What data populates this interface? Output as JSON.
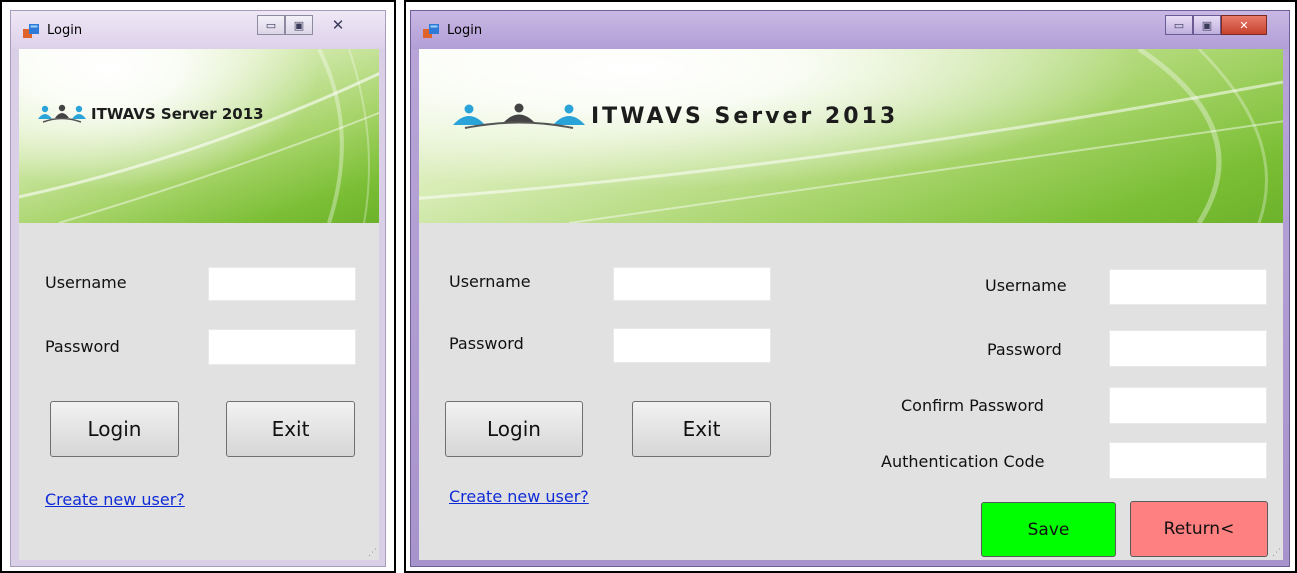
{
  "window_left": {
    "title": "Login",
    "logo_text": "ITWAVS Server 2013",
    "form": {
      "username_label": "Username",
      "password_label": "Password",
      "login_button": "Login",
      "exit_button": "Exit",
      "create_user_link": "Create new user?"
    }
  },
  "window_right": {
    "title": "Login",
    "logo_text": "ITWAVS Server 2013",
    "login_form": {
      "username_label": "Username",
      "password_label": "Password",
      "login_button": "Login",
      "exit_button": "Exit",
      "create_user_link": "Create new user?"
    },
    "register_form": {
      "username_label": "Username",
      "password_label": "Password",
      "confirm_password_label": "Confirm Password",
      "auth_code_label": "Authentication Code",
      "save_button": "Save",
      "return_button": "Return<"
    }
  },
  "window_controls": {
    "minimize_glyph": "▭",
    "maximize_glyph": "▣",
    "close_glyph": "✕"
  },
  "colors": {
    "save_button": "#00ff00",
    "return_button": "#ff8080",
    "link": "#0f2bd6"
  }
}
